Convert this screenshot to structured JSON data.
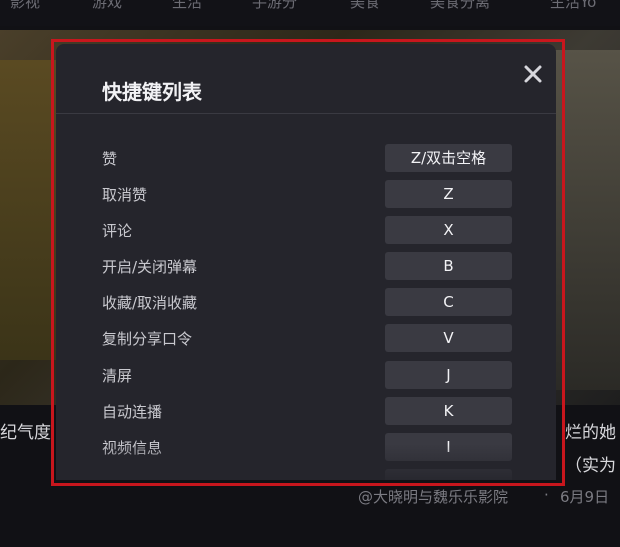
{
  "topnav": {
    "items": [
      "影视",
      "游戏",
      "生活",
      "手游分",
      "美食",
      "美食分离",
      "生活Yo"
    ]
  },
  "background": {
    "caption_left": "纪气度",
    "caption_right_1": "烂的她",
    "caption_right_2": "（实为",
    "author": "@大晓明与魏乐乐影院",
    "separator": "·",
    "date": "6月9日"
  },
  "modal": {
    "title": "快捷键列表",
    "close_label": "×",
    "shortcuts": [
      {
        "label": "赞",
        "key": "Z/双击空格"
      },
      {
        "label": "取消赞",
        "key": "Z"
      },
      {
        "label": "评论",
        "key": "X"
      },
      {
        "label": "开启/关闭弹幕",
        "key": "B"
      },
      {
        "label": "收藏/取消收藏",
        "key": "C"
      },
      {
        "label": "复制分享口令",
        "key": "V"
      },
      {
        "label": "清屏",
        "key": "J"
      },
      {
        "label": "自动连播",
        "key": "K"
      },
      {
        "label": "视频信息",
        "key": "I"
      },
      {
        "label": "",
        "key": ""
      }
    ]
  },
  "colors": {
    "modal_bg": "#25252c",
    "key_bg": "#3a3a42",
    "highlight": "#c8161d",
    "text": "#c9c9cf"
  }
}
